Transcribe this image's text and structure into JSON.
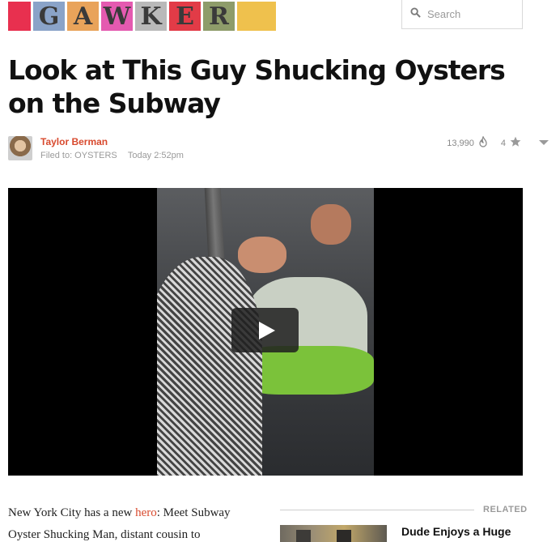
{
  "header": {
    "logo": {
      "letters": [
        "G",
        "A",
        "W",
        "K",
        "E",
        "R"
      ],
      "colors": {
        "cap_left": "#e8304f",
        "tiles": [
          "#8aa3c8",
          "#e9a35a",
          "#e45ab0",
          "#b9b9b9",
          "#e23b47",
          "#8e9c6a"
        ],
        "cap_right": "#efc14d"
      }
    },
    "search": {
      "placeholder": "Search",
      "icon": "search-icon"
    }
  },
  "article": {
    "headline": "Look at This Guy Shucking Oysters on the Subway",
    "author": "Taylor Berman",
    "filed_to": "Filed to: OYSTERS",
    "timestamp": "Today 2:52pm",
    "views": "13,990",
    "stars": "4",
    "body_prefix": "New York City has a new ",
    "body_link": "hero",
    "body_suffix": ": Meet Subway Oyster Shucking Man, distant cousin to"
  },
  "video": {
    "play_icon": "play-icon"
  },
  "related": {
    "label": "RELATED",
    "title": "Dude Enjoys a Huge"
  },
  "colors": {
    "accent": "#d84a2e",
    "muted": "#9a9a9a"
  }
}
